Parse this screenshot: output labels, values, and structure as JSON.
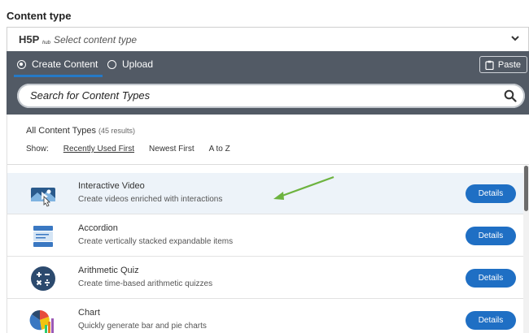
{
  "section_label": "Content type",
  "selector": {
    "placeholder": "Select content type",
    "logo_text": "H5P hub"
  },
  "tabs": [
    {
      "label": "Create Content",
      "selected": true
    },
    {
      "label": "Upload",
      "selected": false
    }
  ],
  "paste_label": "Paste",
  "search": {
    "placeholder": "Search for Content Types"
  },
  "results": {
    "title": "All Content Types",
    "count": "(45 results)"
  },
  "sort": {
    "show_label": "Show:",
    "options": [
      "Recently Used First",
      "Newest First",
      "A to Z"
    ],
    "active": "Recently Used First"
  },
  "items": [
    {
      "title": "Interactive Video",
      "description": "Create videos enriched with interactions",
      "button": "Details",
      "icon": "interactive-video-icon"
    },
    {
      "title": "Accordion",
      "description": "Create vertically stacked expandable items",
      "button": "Details",
      "icon": "accordion-icon"
    },
    {
      "title": "Arithmetic Quiz",
      "description": "Create time-based arithmetic quizzes",
      "button": "Details",
      "icon": "arithmetic-quiz-icon"
    },
    {
      "title": "Chart",
      "description": "Quickly generate bar and pie charts",
      "button": "Details",
      "icon": "chart-icon"
    }
  ],
  "colors": {
    "panel_bg": "#525a65",
    "accent": "#1f6fc4",
    "highlight_row": "#edf3f9",
    "annotation_arrow": "#6db33f"
  }
}
